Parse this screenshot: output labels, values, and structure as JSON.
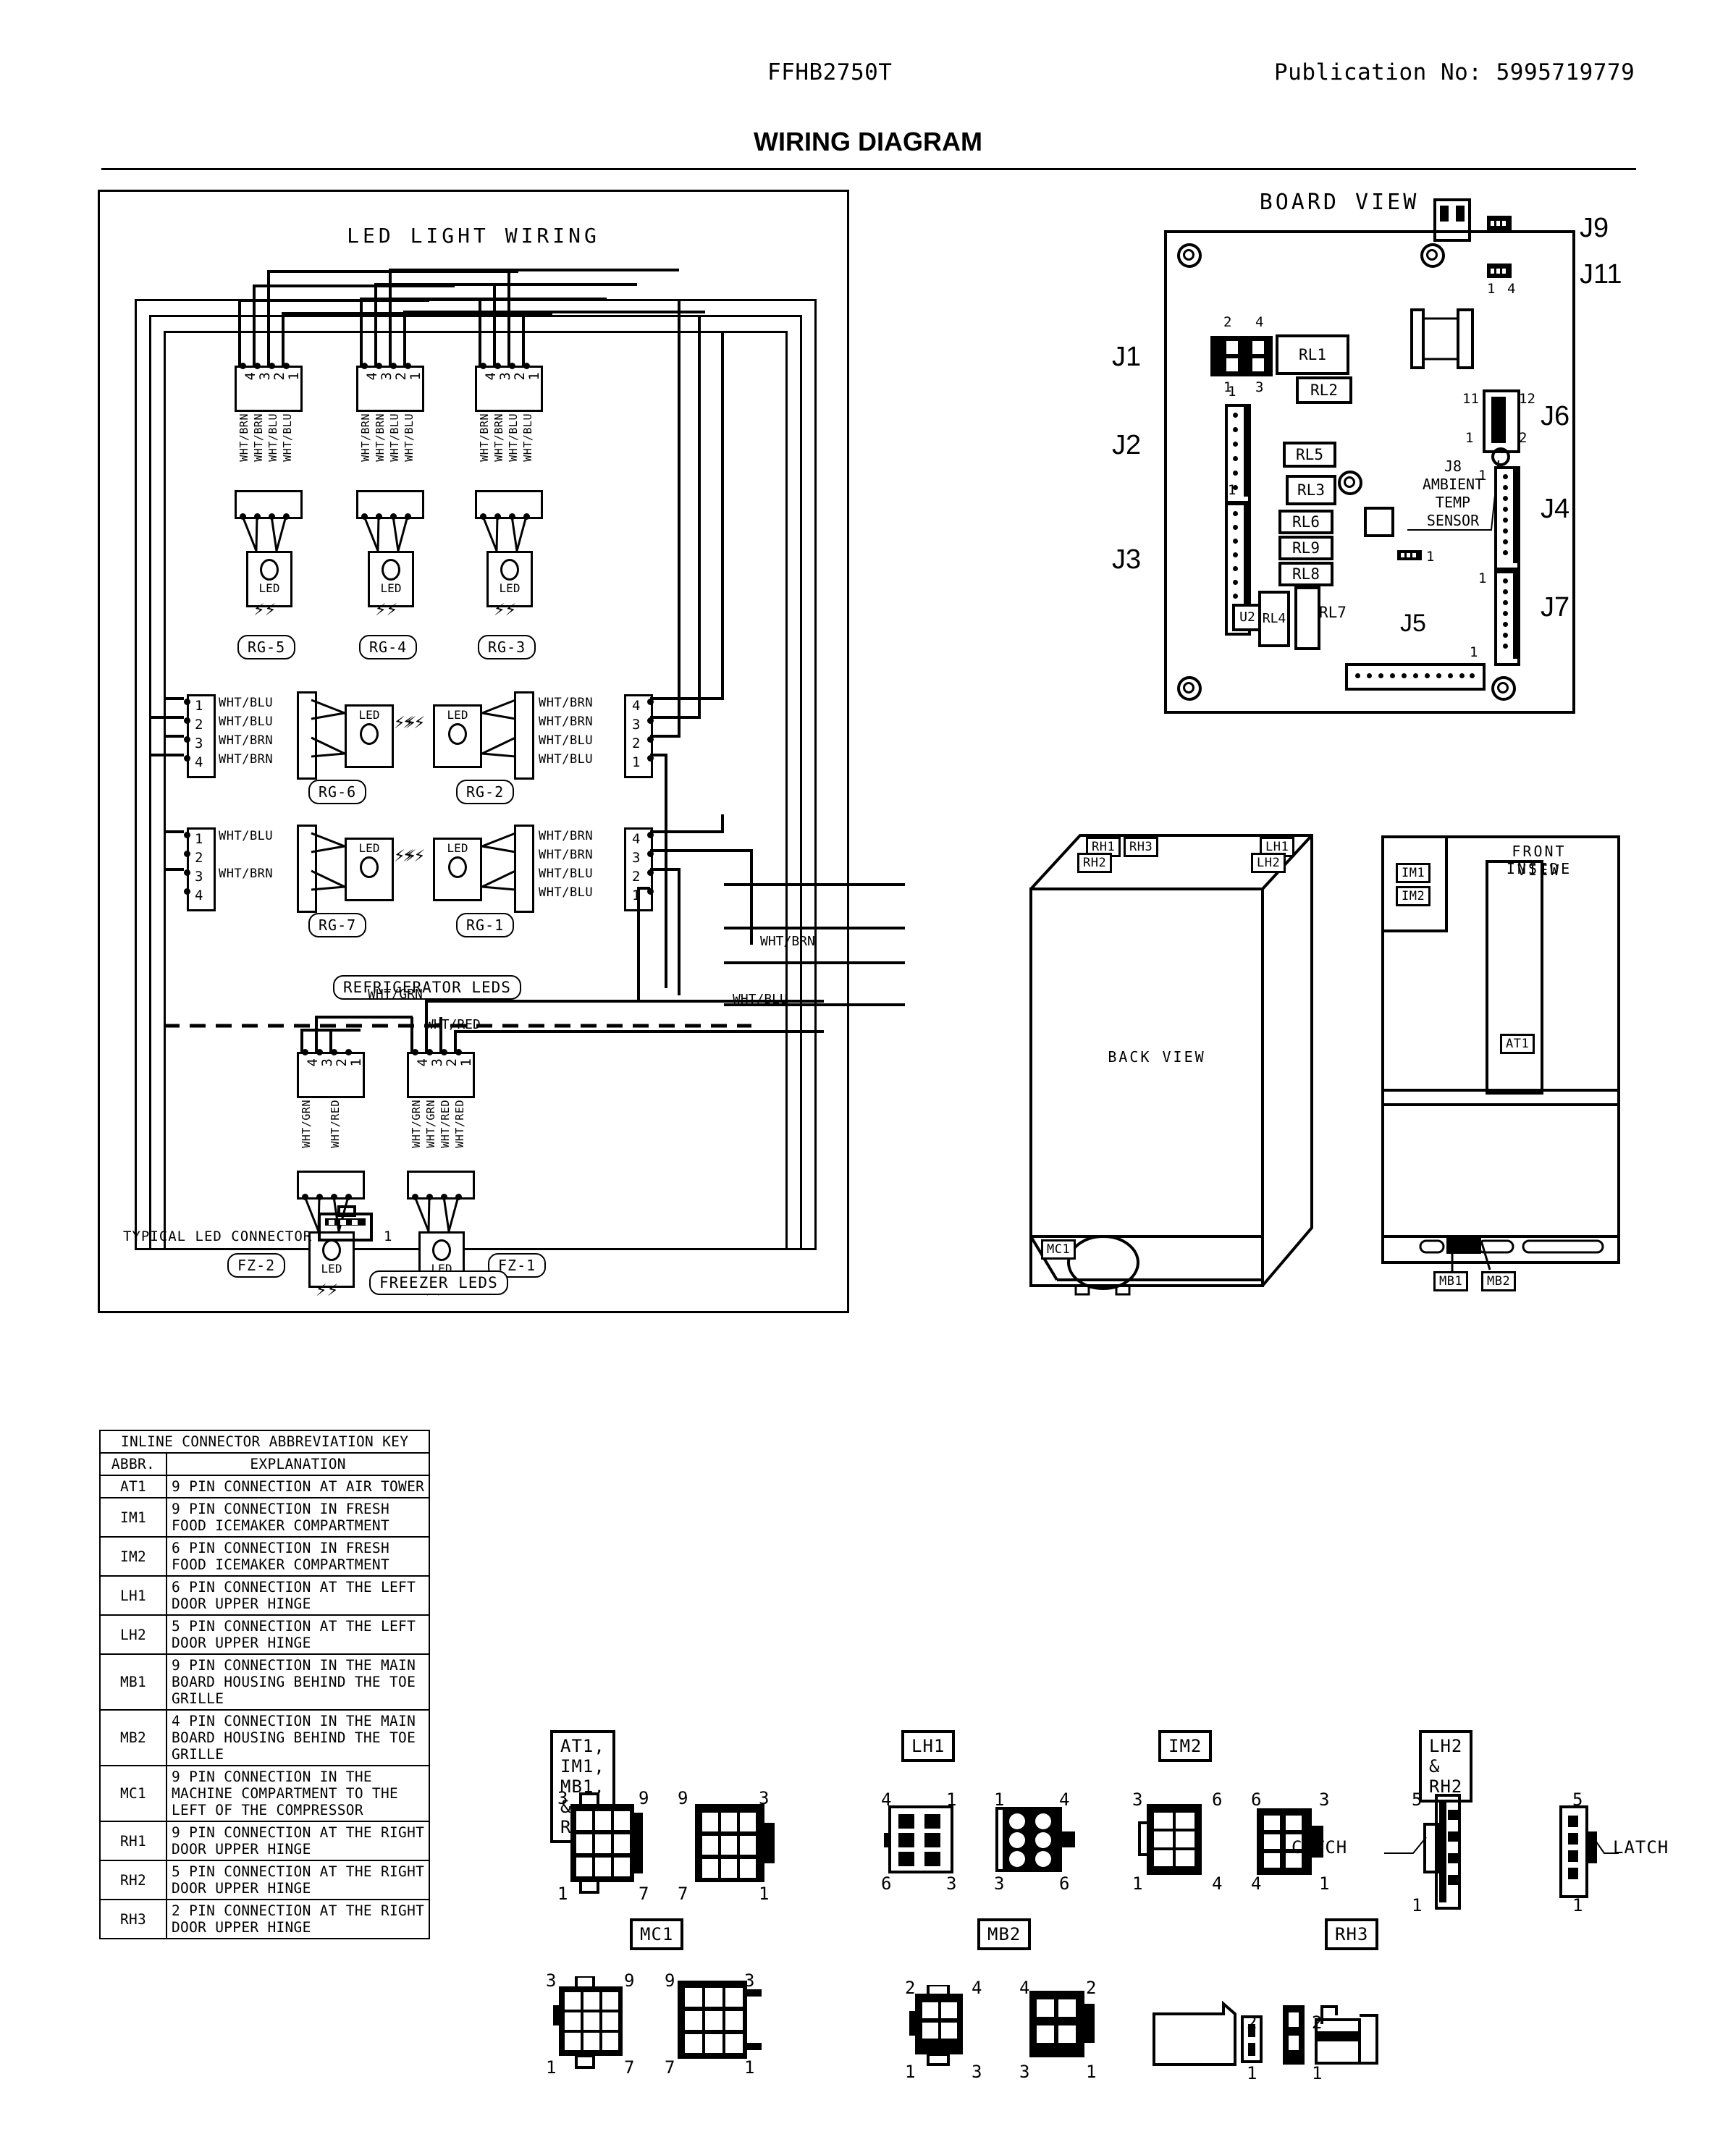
{
  "header": {
    "model": "FFHB2750T",
    "publication": "Publication No:  5995719779",
    "title": "WIRING DIAGRAM"
  },
  "led_panel": {
    "title": "LED LIGHT WIRING",
    "refrigerator_label": "REFRIGERATOR LEDS",
    "freezer_label": "FREEZER LEDS",
    "typical_connector_label": "TYPICAL LED CONNECTOR",
    "typical_connector_pin": "1",
    "top_connectors": [
      {
        "name": "RG-5",
        "pins": [
          "4",
          "3",
          "2",
          "1"
        ],
        "wires": [
          "WHT/BRN",
          "WHT/BRN",
          "WHT/BLU",
          "WHT/BLU"
        ],
        "led": "LED"
      },
      {
        "name": "RG-4",
        "pins": [
          "4",
          "3",
          "2",
          "1"
        ],
        "wires": [
          "WHT/BRN",
          "WHT/BRN",
          "WHT/BLU",
          "WHT/BLU"
        ],
        "led": "LED"
      },
      {
        "name": "RG-3",
        "pins": [
          "4",
          "3",
          "2",
          "1"
        ],
        "wires": [
          "WHT/BRN",
          "WHT/BRN",
          "WHT/BLU",
          "WHT/BLU"
        ],
        "led": "LED"
      }
    ],
    "left_connectors": [
      {
        "name": "RG-6",
        "pins": [
          "1",
          "2",
          "3",
          "4"
        ],
        "wires": [
          "WHT/BLU",
          "WHT/BLU",
          "WHT/BRN",
          "WHT/BRN"
        ],
        "led": "LED"
      },
      {
        "name": "RG-7",
        "pins": [
          "1",
          "2",
          "3",
          "4"
        ],
        "wires": [
          "WHT/BLU",
          "",
          "WHT/BRN",
          ""
        ],
        "led": "LED"
      }
    ],
    "right_connectors": [
      {
        "name": "RG-2",
        "pins": [
          "4",
          "3",
          "2",
          "1"
        ],
        "wires": [
          "WHT/BRN",
          "WHT/BRN",
          "WHT/BLU",
          "WHT/BLU"
        ],
        "led": "LED"
      },
      {
        "name": "RG-1",
        "pins": [
          "4",
          "3",
          "2",
          "1"
        ],
        "wires": [
          "WHT/BRN",
          "WHT/BRN",
          "WHT/BLU",
          "WHT/BLU"
        ],
        "led": "LED"
      }
    ],
    "freezer_connectors": [
      {
        "name": "FZ-2",
        "pins": [
          "4",
          "3",
          "2",
          "1"
        ],
        "wires": [
          "WHT/GRN",
          "",
          "WHT/RED",
          ""
        ],
        "led": "LED"
      },
      {
        "name": "FZ-1",
        "pins": [
          "4",
          "3",
          "2",
          "1"
        ],
        "wires": [
          "WHT/GRN",
          "WHT/GRN",
          "WHT/RED",
          "WHT/RED"
        ],
        "led": "LED"
      }
    ],
    "bus_labels": [
      "WHT/GRN",
      "WHT/RED",
      "WHT/BRN",
      "WHT/BLU"
    ]
  },
  "board": {
    "title": "BOARD VIEW",
    "connectors": [
      "J1",
      "J2",
      "J3",
      "J9",
      "J11",
      "J6",
      "J4",
      "J7",
      "J5"
    ],
    "j1_pins": [
      "2",
      "4",
      "1",
      "3"
    ],
    "j2_pin1": "1",
    "j3_pin1": "1",
    "j11_pins": [
      "1",
      "4"
    ],
    "j6_pins": [
      "11",
      "12",
      "1",
      "2"
    ],
    "j4_pin1": "1",
    "j7_pin1": "1",
    "j5_pin1": "1",
    "j10_pin1": "1",
    "sensor_label": "J8\nAMBIENT\nTEMP\nSENSOR",
    "sensor_lines": [
      "J8",
      "AMBIENT",
      "TEMP",
      "SENSOR"
    ],
    "relays": [
      "RL1",
      "RL2",
      "RL5",
      "RL3",
      "RL6",
      "RL9",
      "RL8",
      "U2",
      "RL4",
      "RL7"
    ]
  },
  "back_view": {
    "label": "BACK VIEW",
    "tags": [
      "RH1",
      "RH3",
      "LH1",
      "RH2",
      "LH2",
      "MC1"
    ]
  },
  "front_view": {
    "label_line1": "FRONT INSIDE",
    "label_line2": "VIEW",
    "tags": [
      "IM1",
      "IM2",
      "AT1",
      "MB1",
      "MB2"
    ]
  },
  "key_table": {
    "title": "INLINE CONNECTOR ABBREVIATION KEY",
    "col_abbr": "ABBR.",
    "col_expl": "EXPLANATION",
    "rows": [
      {
        "abbr": "AT1",
        "lines": [
          "9 PIN CONNECTION AT AIR TOWER"
        ]
      },
      {
        "abbr": "IM1",
        "lines": [
          "9 PIN CONNECTION IN FRESH",
          "FOOD ICEMAKER COMPARTMENT"
        ]
      },
      {
        "abbr": "IM2",
        "lines": [
          "6 PIN CONNECTION IN FRESH",
          "FOOD ICEMAKER COMPARTMENT"
        ]
      },
      {
        "abbr": "LH1",
        "lines": [
          "6 PIN CONNECTION AT THE LEFT",
          "DOOR UPPER HINGE"
        ]
      },
      {
        "abbr": "LH2",
        "lines": [
          "5 PIN CONNECTION AT THE LEFT",
          "DOOR UPPER HINGE"
        ]
      },
      {
        "abbr": "MB1",
        "lines": [
          "9 PIN CONNECTION IN THE MAIN",
          "BOARD HOUSING BEHIND THE TOE",
          "GRILLE"
        ]
      },
      {
        "abbr": "MB2",
        "lines": [
          "4 PIN CONNECTION IN THE MAIN",
          "BOARD HOUSING BEHIND THE TOE",
          "GRILLE"
        ]
      },
      {
        "abbr": "MC1",
        "lines": [
          "9 PIN CONNECTION IN THE",
          "MACHINE COMPARTMENT TO THE",
          "LEFT OF THE COMPRESSOR"
        ]
      },
      {
        "abbr": "RH1",
        "lines": [
          "9 PIN CONNECTION AT THE RIGHT",
          "DOOR UPPER HINGE"
        ]
      },
      {
        "abbr": "RH2",
        "lines": [
          "5 PIN CONNECTION AT THE RIGHT",
          "DOOR UPPER HINGE"
        ]
      },
      {
        "abbr": "RH3",
        "lines": [
          "2 PIN CONNECTION AT THE RIGHT",
          "DOOR UPPER HINGE"
        ]
      }
    ]
  },
  "pinout_figs": {
    "group1": {
      "title": "AT1, IM1, MB1, & RH1",
      "left_corners": [
        "3",
        "9",
        "1",
        "7"
      ],
      "right_corners": [
        "9",
        "3",
        "7",
        "1"
      ]
    },
    "group2": {
      "title": "LH1",
      "left_corners": [
        "4",
        "1",
        "6",
        "3"
      ],
      "right_corners": [
        "1",
        "4",
        "3",
        "6"
      ]
    },
    "group3": {
      "title": "IM2",
      "left_corners": [
        "3",
        "6",
        "1",
        "4"
      ],
      "right_corners": [
        "6",
        "3",
        "4",
        "1"
      ]
    },
    "group4": {
      "title": "LH2 & RH2",
      "catch": "CATCH",
      "latch": "LATCH",
      "left_corners": [
        "5",
        "1"
      ],
      "right_corners": [
        "5",
        "1"
      ]
    },
    "group5": {
      "title": "MC1",
      "left_corners": [
        "3",
        "9",
        "1",
        "7"
      ],
      "right_corners": [
        "9",
        "3",
        "7",
        "1"
      ]
    },
    "group6": {
      "title": "MB2",
      "left_corners": [
        "2",
        "4",
        "1",
        "3"
      ],
      "right_corners": [
        "4",
        "2",
        "3",
        "1"
      ]
    },
    "group7": {
      "title": "RH3",
      "left_corners": [
        "2",
        "1"
      ],
      "right_corners": [
        "2",
        "1"
      ]
    }
  }
}
